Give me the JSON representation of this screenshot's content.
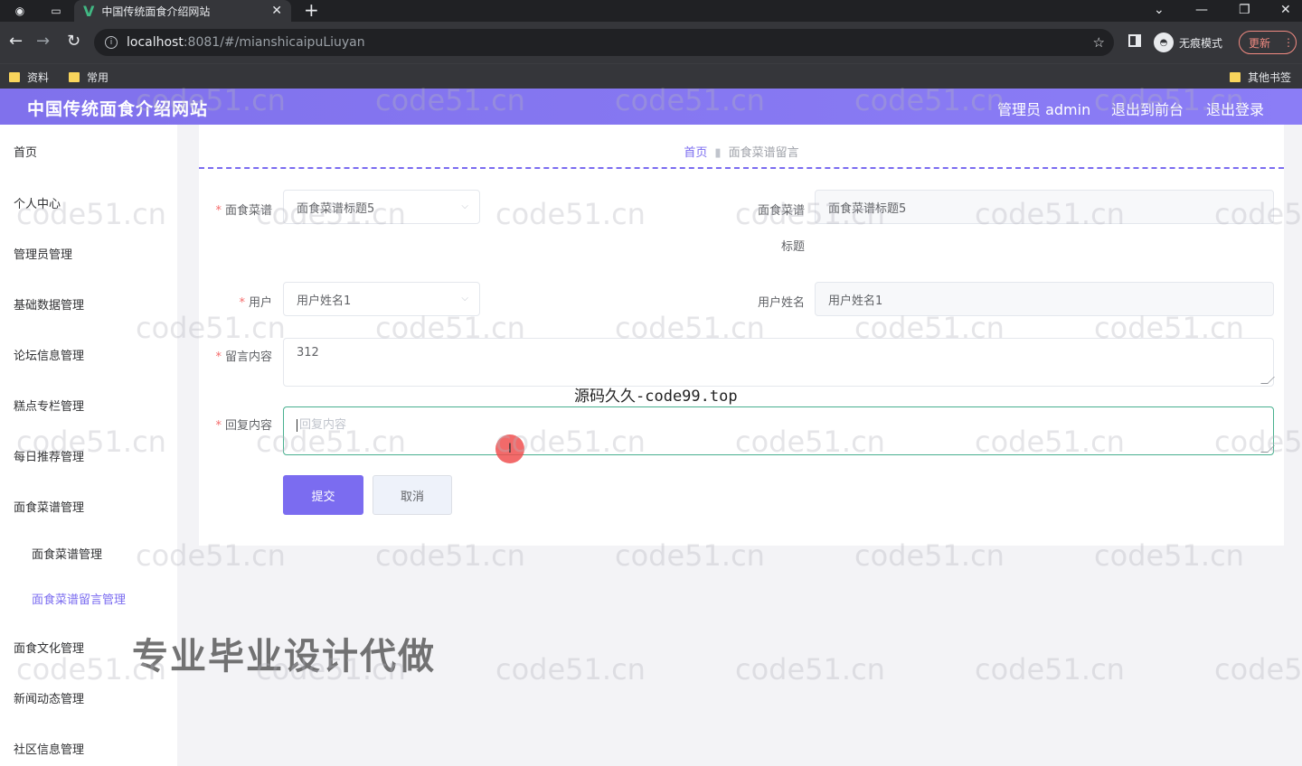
{
  "browser": {
    "tab_title": "中国传统面食介绍网站",
    "tab_close": "✕",
    "new_tab": "+",
    "url_host": "localhost",
    "url_path": ":8081/#/mianshicaipuLiuyan",
    "incognito_label": "无痕模式",
    "update_label": "更新",
    "bookmarks": [
      "资料",
      "常用"
    ],
    "other_bookmarks": "其他书签"
  },
  "header": {
    "site_title": "中国传统面食介绍网站",
    "admin_label": "管理员 admin",
    "to_front": "退出到前台",
    "logout": "退出登录"
  },
  "sidebar": {
    "items": [
      "首页",
      "个人中心",
      "管理员管理",
      "基础数据管理",
      "论坛信息管理",
      "糕点专栏管理",
      "每日推荐管理",
      "面食菜谱管理"
    ],
    "sub_items": [
      "面食菜谱管理",
      "面食菜谱留言管理"
    ],
    "items_after": [
      "面食文化管理",
      "新闻动态管理",
      "社区信息管理"
    ]
  },
  "breadcrumb": {
    "home": "首页",
    "current": "面食菜谱留言"
  },
  "form": {
    "recipe_label": "面食菜谱",
    "recipe_value": "面食菜谱标题5",
    "recipe_title_label_1": "面食菜谱",
    "recipe_title_label_2": "标题",
    "recipe_title_value": "面食菜谱标题5",
    "user_label": "用户",
    "user_value": "用户姓名1",
    "username_label": "用户姓名",
    "username_value": "用户姓名1",
    "message_label": "留言内容",
    "message_value": "312",
    "reply_label": "回复内容",
    "reply_placeholder": "回复内容",
    "submit": "提交",
    "cancel": "取消"
  },
  "overlays": {
    "source_text": "源码久久-code99.top",
    "promo_text": "专业毕业设计代做",
    "watermark": "code51.cn"
  },
  "colors": {
    "accent": "#7b6cf0",
    "header": "#8071ec",
    "focus": "#48b08f"
  }
}
